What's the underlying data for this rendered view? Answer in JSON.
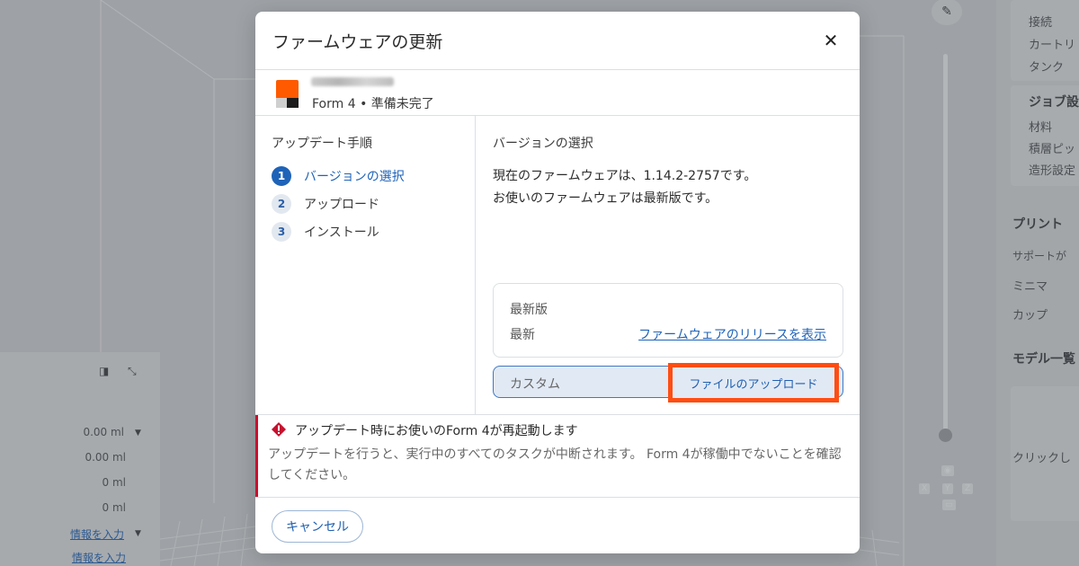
{
  "modal": {
    "title": "ファームウェアの更新",
    "device_status": "Form 4 • 準備未完了",
    "steps_title": "アップデート手順",
    "steps": [
      {
        "num": "1",
        "label": "バージョンの選択",
        "active": true
      },
      {
        "num": "2",
        "label": "アップロード",
        "active": false
      },
      {
        "num": "3",
        "label": "インストール",
        "active": false
      }
    ],
    "content_title": "バージョンの選択",
    "current_firmware": "現在のファームウェアは、1.14.2-2757です。",
    "firmware_latest_note": "お使いのファームウェアは最新版です。",
    "latest_box": {
      "label": "最新版",
      "value": "最新",
      "release_link": "ファームウェアのリリースを表示"
    },
    "custom_box": {
      "label": "カスタム",
      "upload_button": "ファイルのアップロード"
    },
    "warning": {
      "title": "アップデート時にお使いのForm 4が再起動します",
      "text": "アップデートを行うと、実行中のすべてのタスクが中断されます。 Form 4が稼働中でないことを確認してください。"
    },
    "cancel_label": "キャンセル"
  },
  "background": {
    "left_values": [
      "0.00 ml",
      "0.00 ml",
      "0 ml",
      "0 ml",
      "情報を入力",
      "情報を入力"
    ],
    "right_items_top": [
      "接続",
      "カートリ",
      "タンク"
    ],
    "right_head_job": "ジョブ設",
    "right_items_job": [
      "材料",
      "積層ピッ",
      "造形設定"
    ],
    "right_head_print": "プリント",
    "right_items_print": [
      "サポートが",
      "ミニマ",
      "カップ"
    ],
    "right_head_model": "モデル一覧",
    "right_click_hint": "クリックし"
  },
  "colors": {
    "accent_blue": "#1f63b8",
    "highlight_orange": "#ff4d12",
    "warning_red": "#c8102e",
    "brand_orange": "#ff5a00"
  }
}
